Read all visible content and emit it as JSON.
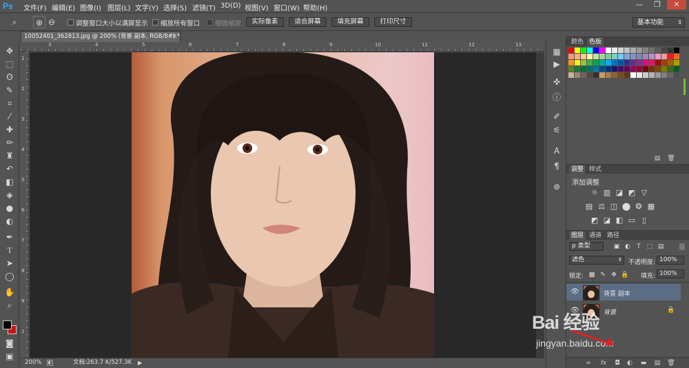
{
  "app": {
    "logo": "Ps"
  },
  "menu": [
    "文件(F)",
    "编辑(E)",
    "图像(I)",
    "图层(L)",
    "文字(Y)",
    "选择(S)",
    "滤镜(T)",
    "3D(D)",
    "视图(V)",
    "窗口(W)",
    "帮助(H)"
  ],
  "window_controls": {
    "minimize": "—",
    "restore": "❐",
    "close": "✕"
  },
  "options_bar": {
    "chk_resize": "调整窗口大小以满屏显示",
    "chk_zoom_all": "缩放所有窗口",
    "chk_scrubby": "细微缩放",
    "btn_actual": "实际像素",
    "btn_fit": "适合屏幕",
    "btn_fill": "填充屏幕",
    "btn_print": "打印尺寸",
    "workspace": "基本功能"
  },
  "document": {
    "tab_title": "10052401_362813.jpg @ 200% (背景 副本, RGB/8#) *",
    "tab_close": "×"
  },
  "ruler": {
    "top_ticks": [
      "3",
      "4",
      "5",
      "6",
      "7",
      "8",
      "9",
      "10",
      "11",
      "12",
      "13"
    ],
    "left_ticks": [
      "1",
      "2",
      "3",
      "4",
      "5",
      "6",
      "7",
      "8",
      "9",
      "1"
    ]
  },
  "status": {
    "zoom": "200%",
    "doc_info": "文档:263.7 K/527.3K"
  },
  "swatches_panel": {
    "tab_color": "颜色",
    "tab_swatches": "色板"
  },
  "swatch_colors": [
    "#ff0000",
    "#ffff00",
    "#00ff00",
    "#00ffff",
    "#0000ff",
    "#ff00ff",
    "#ffffff",
    "#ebebeb",
    "#d6d6d6",
    "#c2c2c2",
    "#adadad",
    "#999999",
    "#858585",
    "#707070",
    "#5c5c5c",
    "#474747",
    "#333333",
    "#000000",
    "#f7977a",
    "#f9ad81",
    "#fdc68a",
    "#fff79a",
    "#c4df9b",
    "#a2d39c",
    "#82ca9d",
    "#7bcdc8",
    "#6ecff6",
    "#7ea7d8",
    "#8493ca",
    "#8882be",
    "#a187be",
    "#bc8dbf",
    "#f49ac2",
    "#f6989d",
    "#ed1c24",
    "#f26522",
    "#f7941d",
    "#fff200",
    "#8dc73f",
    "#39b54a",
    "#00a651",
    "#00a99d",
    "#00aeef",
    "#0072bc",
    "#0054a6",
    "#2e3192",
    "#662d91",
    "#92278f",
    "#ec008c",
    "#ed145b",
    "#9e0b0f",
    "#a0410d",
    "#a3620a",
    "#aba000",
    "#598527",
    "#1a7b30",
    "#007236",
    "#00746b",
    "#0076a3",
    "#004b80",
    "#003471",
    "#1b1464",
    "#440e62",
    "#630460",
    "#9e005d",
    "#9e0039",
    "#790000",
    "#7b2e00",
    "#7d4900",
    "#827b00",
    "#406618",
    "#005e20",
    "#c7b299",
    "#998675",
    "#736357",
    "#534741",
    "#37302d",
    "#c69c6d",
    "#a67c52",
    "#8c6239",
    "#754c24",
    "#603913",
    "#ffffff",
    "#e6e6e6",
    "#cccccc",
    "#b3b3b3",
    "#999999",
    "#808080",
    "#666666",
    "#4d4d4d"
  ],
  "adjustments_panel": {
    "tab_adjust": "调整",
    "tab_styles": "样式",
    "title": "添加调整"
  },
  "layers_panel": {
    "tab_layers": "图层",
    "tab_channels": "通道",
    "tab_paths": "路径",
    "filter_kind": "ρ 类型",
    "blend_mode": "滤色",
    "opacity_label": "不透明度:",
    "opacity_value": "100%",
    "lock_label": "锁定:",
    "fill_label": "填充:",
    "fill_value": "100%",
    "layers": [
      {
        "name": "背景 副本",
        "selected": true
      },
      {
        "name": "背景",
        "selected": false
      }
    ]
  },
  "watermark": {
    "logo": "Bai 经验",
    "url": "jingyan.baidu.com"
  },
  "colors": {
    "accent_selected": "#5b6e86",
    "ps_blue": "#31a8ff",
    "foreground": "#000000",
    "background": "#cc1111"
  }
}
